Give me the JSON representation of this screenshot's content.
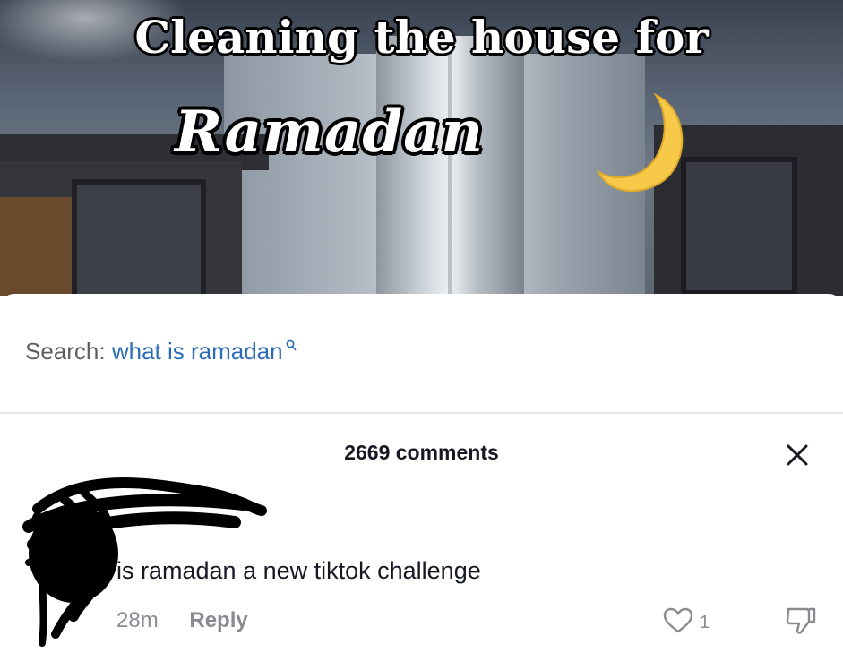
{
  "video": {
    "headline": "Cleaning the house for",
    "script_word": "Ramadan",
    "moon_icon": "crescent-moon-icon"
  },
  "search": {
    "label": "Search:",
    "query": "what is ramadan",
    "icon": "search-icon"
  },
  "comments": {
    "count_label": "2669 comments",
    "close_icon": "close-icon",
    "items": [
      {
        "text": "is ramadan a new tiktok challenge",
        "time": "28m",
        "reply_label": "Reply",
        "likes": "1",
        "like_icon": "heart-icon",
        "dislike_icon": "thumbs-down-icon"
      }
    ]
  },
  "colors": {
    "link_blue": "#2c6cb6",
    "text_dark": "#161823",
    "text_gray": "#8a8b91",
    "moon_yellow": "#f7c948"
  }
}
